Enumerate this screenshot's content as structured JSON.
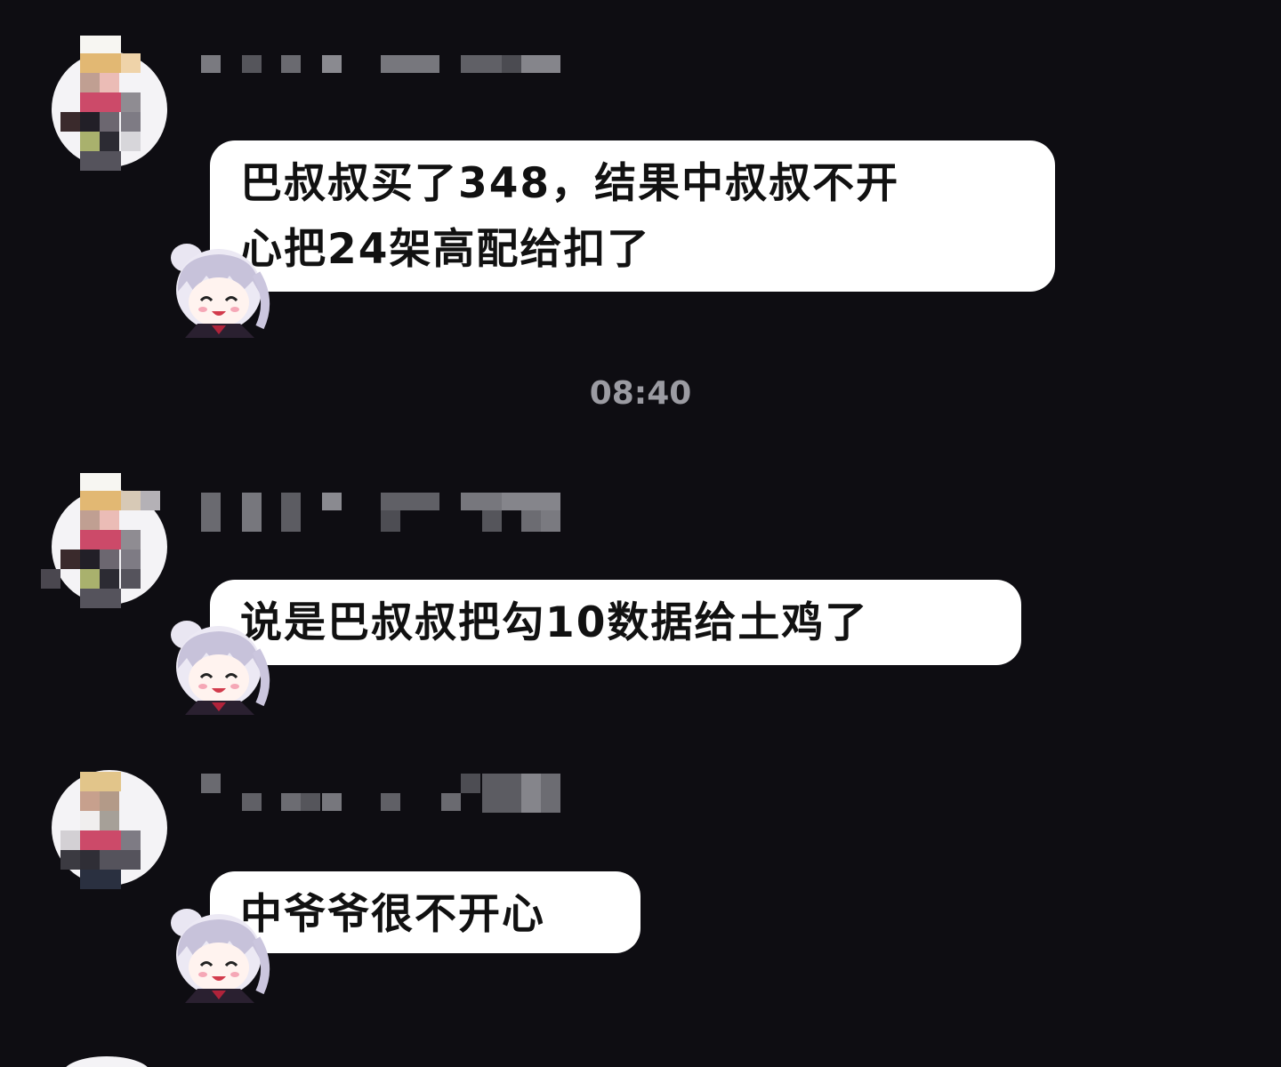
{
  "messages": [
    {
      "sender": "",
      "text_lines": [
        "巴叔叔买了348，结果中叔叔不开",
        "心把24架高配给扣了"
      ]
    },
    {
      "sender": "",
      "text_lines": [
        "说是巴叔叔把勾10数据给土鸡了"
      ]
    },
    {
      "sender": "",
      "text_lines": [
        "中爷爷很不开心"
      ]
    }
  ],
  "timestamp": "08:40",
  "colors": {
    "background": "#0e0d12",
    "bubble": "#ffffff",
    "bubble_text": "#111111",
    "timestamp": "#9b9ba2"
  },
  "icons": {
    "avatar": "pixelated-avatar-icon",
    "sticker": "anime-girl-sticker-icon"
  }
}
